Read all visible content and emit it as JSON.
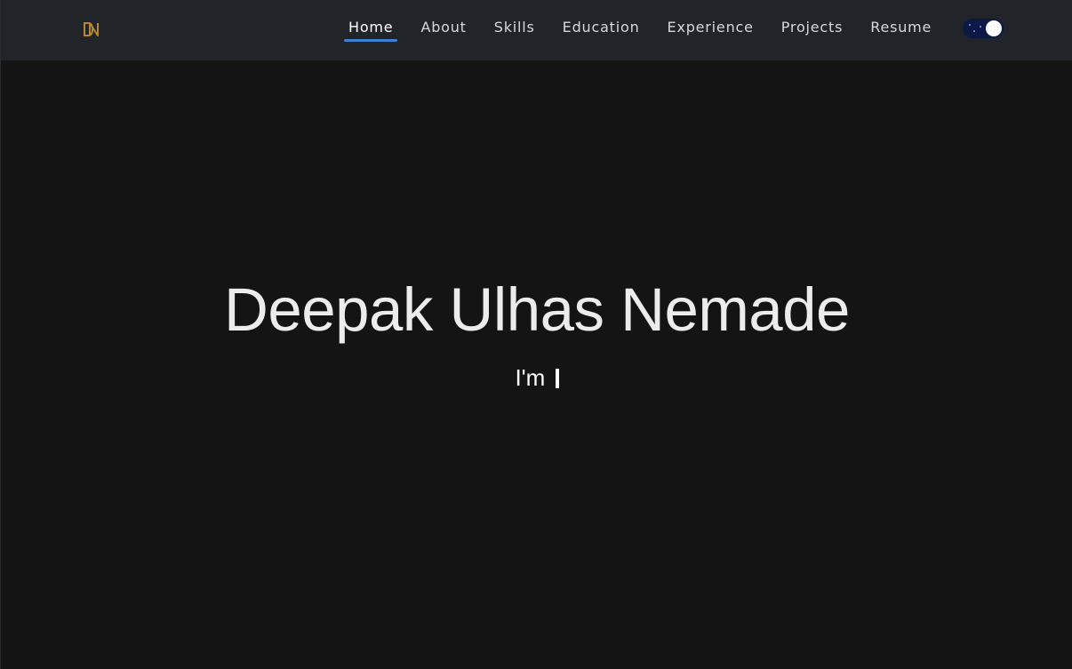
{
  "navbar": {
    "logo_icon": "dn-monogram-logo",
    "logo_color": "#b8862e",
    "links": [
      {
        "label": "Home",
        "active": true
      },
      {
        "label": "About",
        "active": false
      },
      {
        "label": "Skills",
        "active": false
      },
      {
        "label": "Education",
        "active": false
      },
      {
        "label": "Experience",
        "active": false
      },
      {
        "label": "Projects",
        "active": false
      },
      {
        "label": "Resume",
        "active": false
      }
    ],
    "active_underline_color": "#3e82d6",
    "theme_toggle": {
      "state": "on",
      "track_color": "#0c1947",
      "knob_color": "#ffffff"
    }
  },
  "hero": {
    "name": "Deepak Ulhas Nemade",
    "typing_prefix": "I'm",
    "typing_text": ""
  },
  "colors": {
    "background": "#141414",
    "navbar_background": "#212428",
    "text": "#ececec"
  }
}
